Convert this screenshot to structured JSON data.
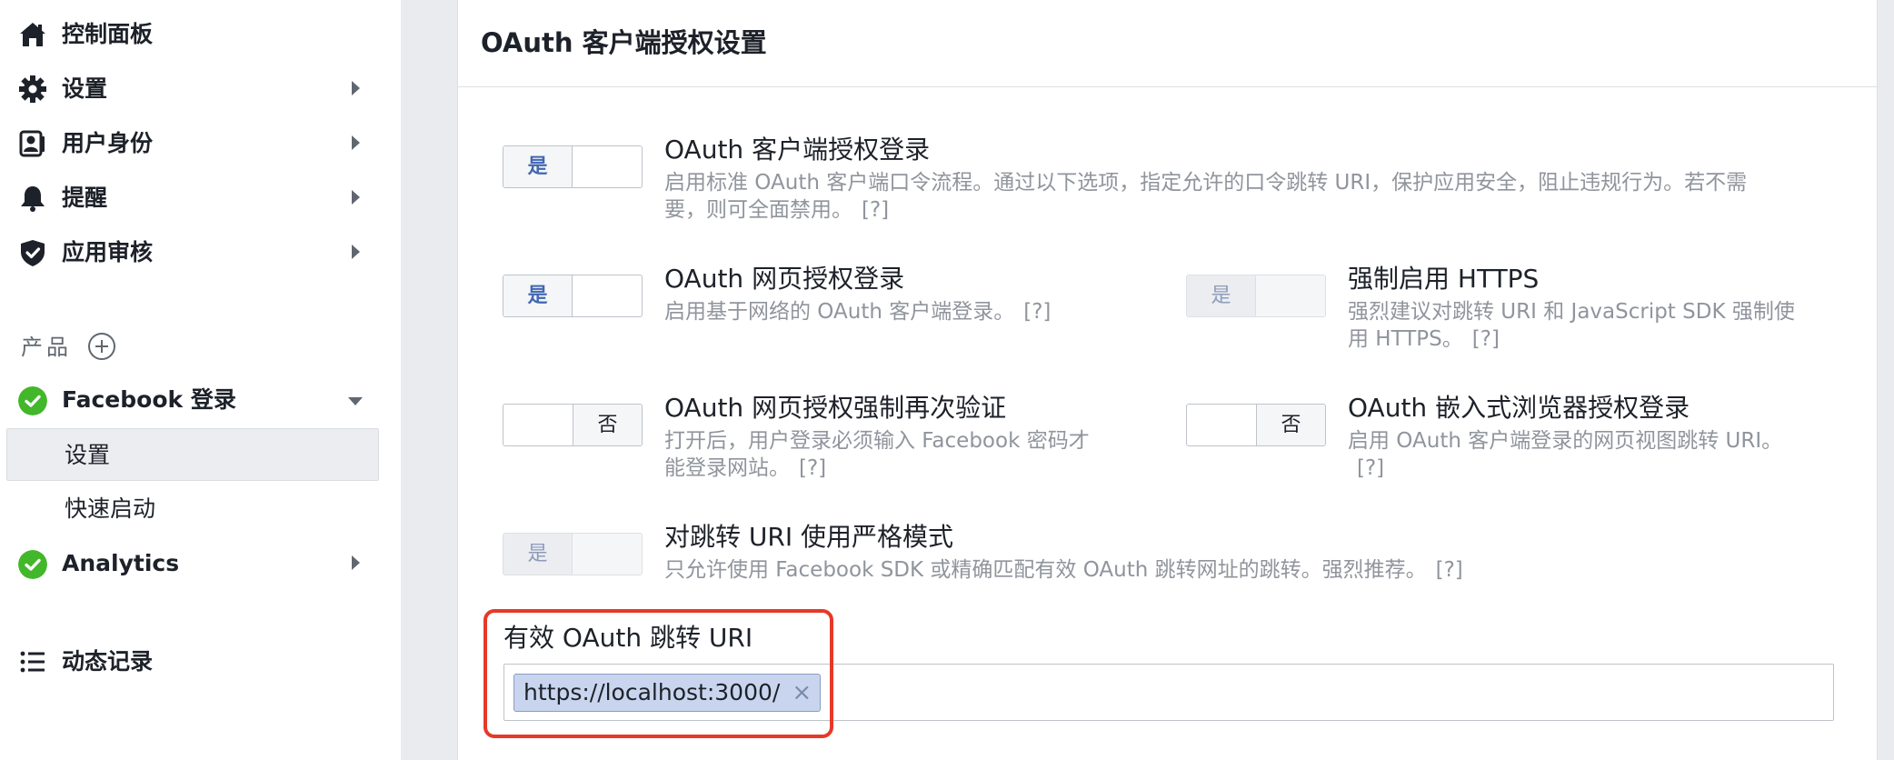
{
  "sidebar": {
    "items": [
      {
        "label": "控制面板",
        "icon": "home-icon"
      },
      {
        "label": "设置",
        "icon": "gear-icon"
      },
      {
        "label": "用户身份",
        "icon": "user-badge-icon"
      },
      {
        "label": "提醒",
        "icon": "bell-icon"
      },
      {
        "label": "应用审核",
        "icon": "shield-check-icon"
      }
    ],
    "products_label": "产品",
    "facebook_login": {
      "label": "Facebook 登录",
      "sub_items": [
        {
          "label": "设置",
          "active": true
        },
        {
          "label": "快速启动",
          "active": false
        }
      ]
    },
    "analytics": {
      "label": "Analytics"
    },
    "activity_log": {
      "label": "动态记录",
      "icon": "list-icon"
    }
  },
  "panel": {
    "title": "OAuth 客户端授权设置",
    "options": [
      {
        "title": "OAuth 客户端授权登录",
        "desc": "启用标准 OAuth 客户端口令流程。通过以下选项，指定允许的口令跳转 URI，保护应用安全，阻止违规行为。若不需要，则可全面禁用。",
        "help": "[?]",
        "state": "是"
      },
      {
        "title": "OAuth 网页授权登录",
        "desc": "启用基于网络的 OAuth 客户端登录。",
        "help": "[?]",
        "state": "是"
      },
      {
        "title": "强制启用 HTTPS",
        "desc": "强烈建议对跳转 URI 和 JavaScript SDK 强制使用 HTTPS。",
        "help": "[?]",
        "state": "是"
      },
      {
        "title": "OAuth 网页授权强制再次验证",
        "desc": "打开后，用户登录必须输入 Facebook 密码才能登录网站。",
        "help": "[?]",
        "state": "否"
      },
      {
        "title": "OAuth 嵌入式浏览器授权登录",
        "desc": "启用 OAuth 客户端登录的网页视图跳转 URI。",
        "help": "[?]",
        "state": "否"
      },
      {
        "title": "对跳转 URI 使用严格模式",
        "desc": "只允许使用 Facebook SDK 或精确匹配有效 OAuth 跳转网址的跳转。强烈推荐。",
        "help": "[?]",
        "state": "是"
      }
    ],
    "redirect_uris": {
      "label": "有效 OAuth 跳转 URI",
      "tokens": [
        "https://localhost:3000/"
      ],
      "remove_glyph": "×"
    }
  },
  "colors": {
    "accent": "#4267b2",
    "success": "#42b72a",
    "highlight": "#e53a28"
  }
}
